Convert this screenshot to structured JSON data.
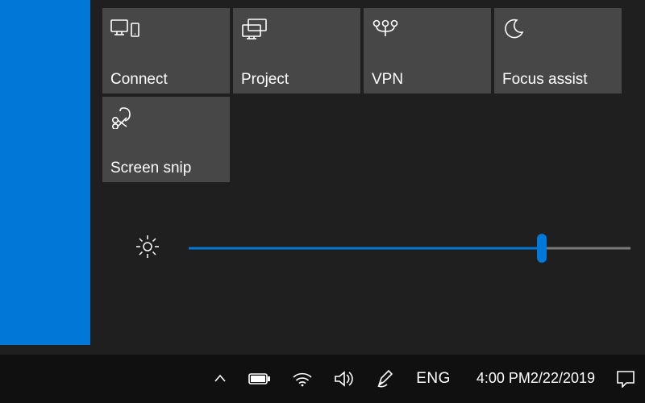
{
  "tiles": {
    "connect": {
      "label": "Connect"
    },
    "project": {
      "label": "Project"
    },
    "vpn": {
      "label": "VPN"
    },
    "focusassist": {
      "label": "Focus assist"
    },
    "screensnip": {
      "label": "Screen snip"
    }
  },
  "brightness": {
    "percent": 80
  },
  "taskbar": {
    "language": "ENG",
    "time": "4:00 PM",
    "date": "2/22/2019"
  }
}
